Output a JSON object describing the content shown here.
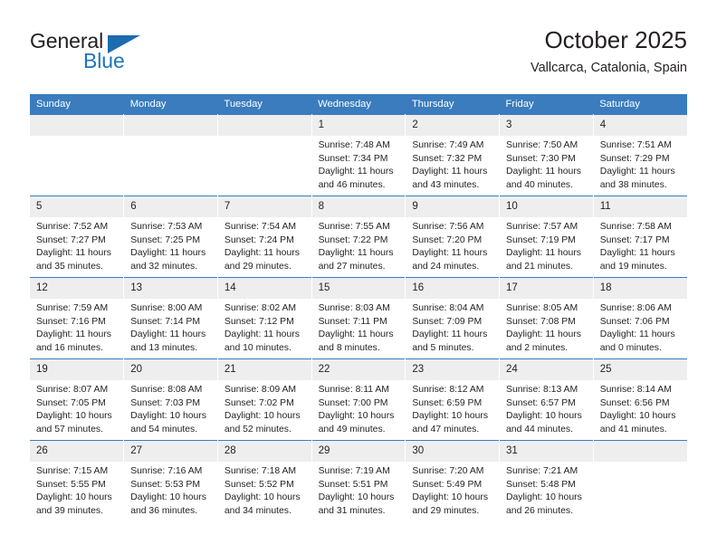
{
  "brand": {
    "line1": "General",
    "line2": "Blue",
    "flag_icon": "triangle-flag-icon",
    "accent_color": "#1c75bc"
  },
  "header": {
    "title": "October 2025",
    "location": "Vallcarca, Catalonia, Spain"
  },
  "theme": {
    "header_row_bg": "#3a7cbe",
    "daynum_bg": "#eeeeee",
    "row_separator": "#3a7cbe",
    "text": "#231f20"
  },
  "weekday_headers": [
    "Sunday",
    "Monday",
    "Tuesday",
    "Wednesday",
    "Thursday",
    "Friday",
    "Saturday"
  ],
  "labels": {
    "sunrise_prefix": "Sunrise:",
    "sunset_prefix": "Sunset:",
    "daylight_prefix": "Daylight:"
  },
  "weeks": [
    [
      {
        "day": "",
        "lines": []
      },
      {
        "day": "",
        "lines": []
      },
      {
        "day": "",
        "lines": []
      },
      {
        "day": "1",
        "lines": [
          "Sunrise: 7:48 AM",
          "Sunset: 7:34 PM",
          "Daylight: 11 hours",
          "and 46 minutes."
        ]
      },
      {
        "day": "2",
        "lines": [
          "Sunrise: 7:49 AM",
          "Sunset: 7:32 PM",
          "Daylight: 11 hours",
          "and 43 minutes."
        ]
      },
      {
        "day": "3",
        "lines": [
          "Sunrise: 7:50 AM",
          "Sunset: 7:30 PM",
          "Daylight: 11 hours",
          "and 40 minutes."
        ]
      },
      {
        "day": "4",
        "lines": [
          "Sunrise: 7:51 AM",
          "Sunset: 7:29 PM",
          "Daylight: 11 hours",
          "and 38 minutes."
        ]
      }
    ],
    [
      {
        "day": "5",
        "lines": [
          "Sunrise: 7:52 AM",
          "Sunset: 7:27 PM",
          "Daylight: 11 hours",
          "and 35 minutes."
        ]
      },
      {
        "day": "6",
        "lines": [
          "Sunrise: 7:53 AM",
          "Sunset: 7:25 PM",
          "Daylight: 11 hours",
          "and 32 minutes."
        ]
      },
      {
        "day": "7",
        "lines": [
          "Sunrise: 7:54 AM",
          "Sunset: 7:24 PM",
          "Daylight: 11 hours",
          "and 29 minutes."
        ]
      },
      {
        "day": "8",
        "lines": [
          "Sunrise: 7:55 AM",
          "Sunset: 7:22 PM",
          "Daylight: 11 hours",
          "and 27 minutes."
        ]
      },
      {
        "day": "9",
        "lines": [
          "Sunrise: 7:56 AM",
          "Sunset: 7:20 PM",
          "Daylight: 11 hours",
          "and 24 minutes."
        ]
      },
      {
        "day": "10",
        "lines": [
          "Sunrise: 7:57 AM",
          "Sunset: 7:19 PM",
          "Daylight: 11 hours",
          "and 21 minutes."
        ]
      },
      {
        "day": "11",
        "lines": [
          "Sunrise: 7:58 AM",
          "Sunset: 7:17 PM",
          "Daylight: 11 hours",
          "and 19 minutes."
        ]
      }
    ],
    [
      {
        "day": "12",
        "lines": [
          "Sunrise: 7:59 AM",
          "Sunset: 7:16 PM",
          "Daylight: 11 hours",
          "and 16 minutes."
        ]
      },
      {
        "day": "13",
        "lines": [
          "Sunrise: 8:00 AM",
          "Sunset: 7:14 PM",
          "Daylight: 11 hours",
          "and 13 minutes."
        ]
      },
      {
        "day": "14",
        "lines": [
          "Sunrise: 8:02 AM",
          "Sunset: 7:12 PM",
          "Daylight: 11 hours",
          "and 10 minutes."
        ]
      },
      {
        "day": "15",
        "lines": [
          "Sunrise: 8:03 AM",
          "Sunset: 7:11 PM",
          "Daylight: 11 hours",
          "and 8 minutes."
        ]
      },
      {
        "day": "16",
        "lines": [
          "Sunrise: 8:04 AM",
          "Sunset: 7:09 PM",
          "Daylight: 11 hours",
          "and 5 minutes."
        ]
      },
      {
        "day": "17",
        "lines": [
          "Sunrise: 8:05 AM",
          "Sunset: 7:08 PM",
          "Daylight: 11 hours",
          "and 2 minutes."
        ]
      },
      {
        "day": "18",
        "lines": [
          "Sunrise: 8:06 AM",
          "Sunset: 7:06 PM",
          "Daylight: 11 hours",
          "and 0 minutes."
        ]
      }
    ],
    [
      {
        "day": "19",
        "lines": [
          "Sunrise: 8:07 AM",
          "Sunset: 7:05 PM",
          "Daylight: 10 hours",
          "and 57 minutes."
        ]
      },
      {
        "day": "20",
        "lines": [
          "Sunrise: 8:08 AM",
          "Sunset: 7:03 PM",
          "Daylight: 10 hours",
          "and 54 minutes."
        ]
      },
      {
        "day": "21",
        "lines": [
          "Sunrise: 8:09 AM",
          "Sunset: 7:02 PM",
          "Daylight: 10 hours",
          "and 52 minutes."
        ]
      },
      {
        "day": "22",
        "lines": [
          "Sunrise: 8:11 AM",
          "Sunset: 7:00 PM",
          "Daylight: 10 hours",
          "and 49 minutes."
        ]
      },
      {
        "day": "23",
        "lines": [
          "Sunrise: 8:12 AM",
          "Sunset: 6:59 PM",
          "Daylight: 10 hours",
          "and 47 minutes."
        ]
      },
      {
        "day": "24",
        "lines": [
          "Sunrise: 8:13 AM",
          "Sunset: 6:57 PM",
          "Daylight: 10 hours",
          "and 44 minutes."
        ]
      },
      {
        "day": "25",
        "lines": [
          "Sunrise: 8:14 AM",
          "Sunset: 6:56 PM",
          "Daylight: 10 hours",
          "and 41 minutes."
        ]
      }
    ],
    [
      {
        "day": "26",
        "lines": [
          "Sunrise: 7:15 AM",
          "Sunset: 5:55 PM",
          "Daylight: 10 hours",
          "and 39 minutes."
        ]
      },
      {
        "day": "27",
        "lines": [
          "Sunrise: 7:16 AM",
          "Sunset: 5:53 PM",
          "Daylight: 10 hours",
          "and 36 minutes."
        ]
      },
      {
        "day": "28",
        "lines": [
          "Sunrise: 7:18 AM",
          "Sunset: 5:52 PM",
          "Daylight: 10 hours",
          "and 34 minutes."
        ]
      },
      {
        "day": "29",
        "lines": [
          "Sunrise: 7:19 AM",
          "Sunset: 5:51 PM",
          "Daylight: 10 hours",
          "and 31 minutes."
        ]
      },
      {
        "day": "30",
        "lines": [
          "Sunrise: 7:20 AM",
          "Sunset: 5:49 PM",
          "Daylight: 10 hours",
          "and 29 minutes."
        ]
      },
      {
        "day": "31",
        "lines": [
          "Sunrise: 7:21 AM",
          "Sunset: 5:48 PM",
          "Daylight: 10 hours",
          "and 26 minutes."
        ]
      },
      {
        "day": "",
        "lines": []
      }
    ]
  ]
}
